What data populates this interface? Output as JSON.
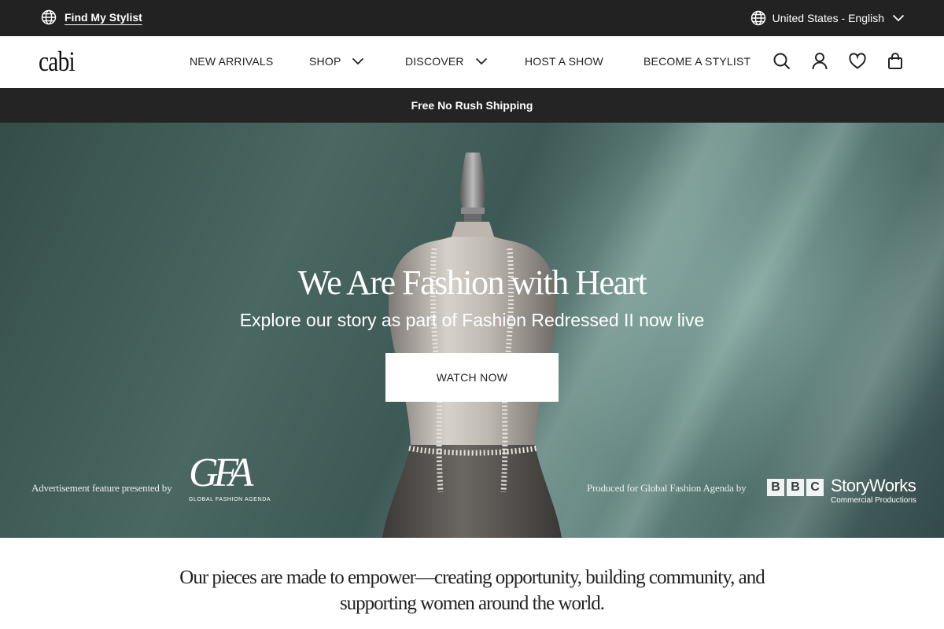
{
  "utility_bar": {
    "find_stylist": "Find My Stylist",
    "locale": "United States - English"
  },
  "nav": {
    "logo": "cabi",
    "items": [
      {
        "label": "NEW ARRIVALS",
        "has_dropdown": false
      },
      {
        "label": "SHOP",
        "has_dropdown": true
      },
      {
        "label": "DISCOVER",
        "has_dropdown": true
      },
      {
        "label": "HOST A SHOW",
        "has_dropdown": false
      },
      {
        "label": "BECOME A STYLIST",
        "has_dropdown": false
      }
    ],
    "icons": [
      "search-icon",
      "account-icon",
      "heart-icon",
      "bag-icon"
    ]
  },
  "promo": {
    "text": "Free No Rush Shipping"
  },
  "hero": {
    "title": "We Are Fashion with Heart",
    "subtitle": "Explore our story as part of Fashion Redressed II now live",
    "cta": "WATCH NOW",
    "credit_left": "Advertisement feature presented by",
    "gfa_mark": "GFA",
    "gfa_name": "GLOBAL FASHION AGENDA",
    "credit_right": "Produced for Global Fashion Agenda by",
    "bbc_letters": [
      "B",
      "B",
      "C"
    ],
    "storyworks": "StoryWorks",
    "storyworks_sub": "Commercial Productions"
  },
  "mission": {
    "text": "Our pieces are made to empower—creating opportunity, building community, and supporting women around the world."
  },
  "colors": {
    "topbar": "#222222",
    "promo": "#242424",
    "hero_teal": "#4a6762"
  }
}
